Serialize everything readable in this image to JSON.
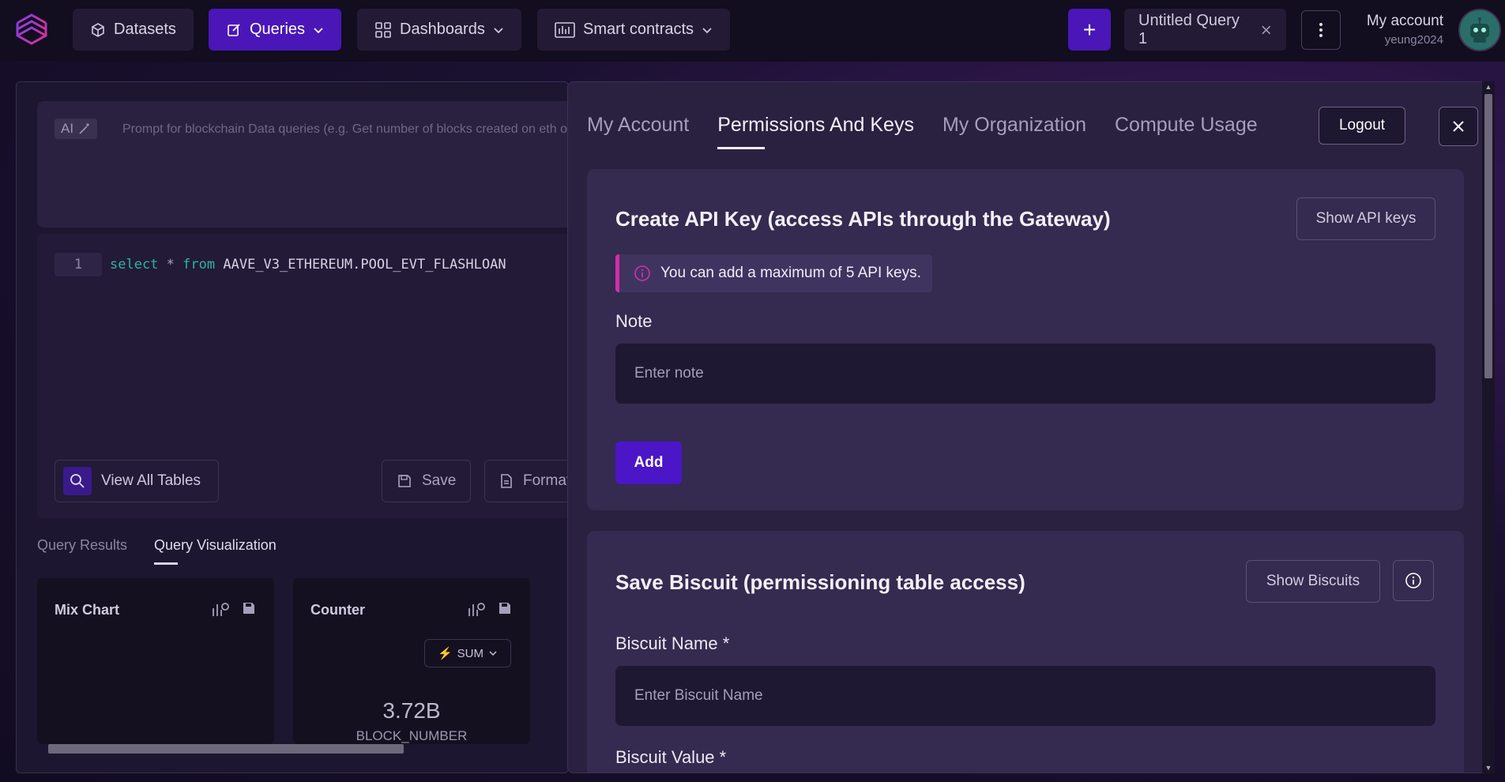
{
  "nav": {
    "datasets": "Datasets",
    "queries": "Queries",
    "dashboards": "Dashboards",
    "smart_contracts": "Smart contracts",
    "plus": "+",
    "query_tab": "Untitled Query 1",
    "account_label": "My account",
    "username": "yeung2024"
  },
  "editor": {
    "ai_chip": "AI",
    "ai_placeholder": "Prompt for blockchain Data queries (e.g. Get number of blocks created on eth ove",
    "line_number": "1",
    "code": {
      "kw1": "select",
      "op": "*",
      "kw2": "from",
      "table": "AAVE_V3_ETHEREUM.POOL_EVT_FLASHLOAN"
    },
    "view_all_tables": "View All Tables",
    "save": "Save",
    "format": "Format"
  },
  "results": {
    "tabs": [
      "Query Results",
      "Query Visualization"
    ],
    "active_tab": "Query Visualization",
    "cards": [
      {
        "title": "Mix Chart"
      },
      {
        "title": "Counter",
        "agg": "SUM",
        "value": "3.72B",
        "label": "BLOCK_NUMBER"
      }
    ]
  },
  "modal": {
    "tabs": [
      "My Account",
      "Permissions And Keys",
      "My Organization",
      "Compute Usage"
    ],
    "active_tab": "Permissions And Keys",
    "logout": "Logout",
    "api_section": {
      "title": "Create API Key (access APIs through the Gateway)",
      "show_button": "Show API keys",
      "notice": "You can add a maximum of 5 API keys.",
      "note_label": "Note",
      "note_placeholder": "Enter note",
      "add_button": "Add"
    },
    "biscuit_section": {
      "title": "Save Biscuit (permissioning table access)",
      "show_button": "Show Biscuits",
      "name_label": "Biscuit Name *",
      "name_placeholder": "Enter Biscuit Name",
      "value_label": "Biscuit Value *"
    }
  },
  "colors": {
    "accent": "#4a16c8",
    "notice_border": "#d22ea8",
    "background": "#120c22"
  }
}
